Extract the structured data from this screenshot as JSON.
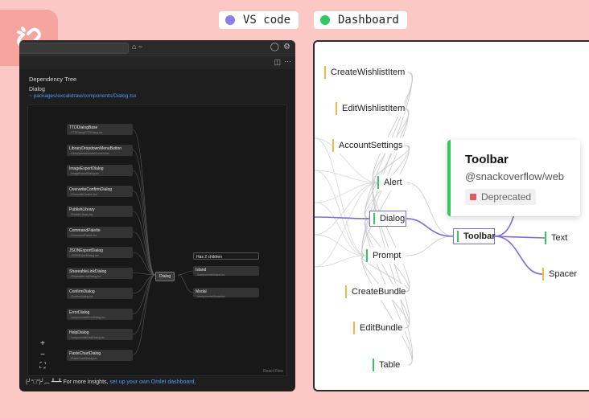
{
  "header": {
    "pills": [
      {
        "label": "VS code",
        "color": "#8b7cf0"
      },
      {
        "label": "Dashboard",
        "color": "#2fc863"
      }
    ]
  },
  "colors": {
    "accent": "#7b6cdc",
    "green": "#34c759",
    "orange": "#f6b73c",
    "deprecated": "#e0585a"
  },
  "vscode": {
    "copilot_label": "⌂ ~",
    "heading": "Dependency Tree",
    "component": "Dialog",
    "path": "~ packages/excalidraw/components/Dialog.tsx",
    "left_nodes": [
      {
        "title": "TTDDialogBase",
        "sub": "../TTDDialog/TTDDialog.tsx"
      },
      {
        "title": "LibraryDropdownMenuButton",
        "sub": "../LibraryMenuHeaderContent.tsx"
      },
      {
        "title": "ImageExportDialog",
        "sub": "../ImageExportDialog.tsx"
      },
      {
        "title": "OverwriteConfirmDialog",
        "sub": "../OverwriteConfirm.tsx"
      },
      {
        "title": "PublishLibrary",
        "sub": "../PublishLibrary.tsx"
      },
      {
        "title": "CommandPalette",
        "sub": "../CommandPalette.tsx"
      },
      {
        "title": "JSONExportDialog",
        "sub": "../JSONExportDialog.tsx"
      },
      {
        "title": "ShareableLinkDialog",
        "sub": "../ShareableLinkDialog.tsx"
      },
      {
        "title": "ConfirmDialog",
        "sub": "../ConfirmDialog.tsx"
      },
      {
        "title": "ErrorDialog",
        "sub": "../components/ErrorDialog.tsx"
      },
      {
        "title": "HelpDialog",
        "sub": "../components/HelpDialog.tsx"
      },
      {
        "title": "PasteChartDialog",
        "sub": "../PasteChartDialog.tsx"
      }
    ],
    "center_node": "Dialog",
    "children_label": "Has 2 children",
    "right_nodes": [
      {
        "title": "Island",
        "sub": "../components/Island.tsx"
      },
      {
        "title": "Modal",
        "sub": "../components/Modal.tsx"
      }
    ],
    "zoom": {
      "plus": "+",
      "minus": "−",
      "fit": "⛶"
    },
    "react_flow": "React Flow",
    "footer_prefix": "(╯°□°)╯︵ ┻━┻ For more insights,",
    "footer_link": "set up your own Omlet dashboard",
    "footer_suffix": "."
  },
  "dashboard": {
    "nodes": [
      {
        "label": "CreateWishlistItem",
        "bar": "orange"
      },
      {
        "label": "EditWishlistItem",
        "bar": "orange"
      },
      {
        "label": "AccountSettings",
        "bar": "orange"
      },
      {
        "label": "Alert",
        "bar": "green"
      },
      {
        "label": "Dialog",
        "bar": "green",
        "selected": true
      },
      {
        "label": "Prompt",
        "bar": "green"
      },
      {
        "label": "CreateBundle",
        "bar": "orange"
      },
      {
        "label": "EditBundle",
        "bar": "orange"
      },
      {
        "label": "Table",
        "bar": "green"
      },
      {
        "label": "Toolbar",
        "bar": "green",
        "selected": true
      },
      {
        "label": "Text",
        "bar": "green"
      },
      {
        "label": "Spacer",
        "bar": "orange"
      }
    ],
    "card": {
      "title": "Toolbar",
      "package": "@snackoverflow/web",
      "badge": "Deprecated"
    }
  }
}
